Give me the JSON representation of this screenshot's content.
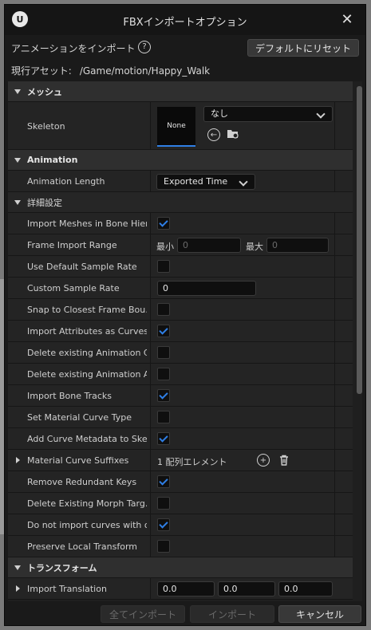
{
  "window": {
    "title": "FBXインポートオプション",
    "logo_glyph": "U",
    "close_glyph": "✕"
  },
  "topbar": {
    "animation_import_label": "アニメーションをインポート",
    "help_glyph": "?",
    "default_reset_button": "デフォルトにリセット"
  },
  "current_asset": {
    "label": "現行アセット:",
    "path": "/Game/motion/Happy_Walk"
  },
  "mesh_section": {
    "title": "メッシュ",
    "skeleton": {
      "label": "Skeleton",
      "thumbnail_text": "None",
      "dropdown_value": "なし",
      "icons": [
        "use-selected-asset-icon",
        "browse-asset-icon"
      ]
    }
  },
  "animation_section": {
    "title": "Animation",
    "animation_length": {
      "label": "Animation Length",
      "value": "Exported Time"
    }
  },
  "advanced_section": {
    "title": "詳細設定",
    "rows": {
      "import_meshes_in_bone_hierarchy": {
        "label": "Import Meshes in Bone Hier…",
        "checked": true
      },
      "frame_import_range": {
        "label": "Frame Import Range",
        "min_label": "最小",
        "min_value": "0",
        "max_label": "最大",
        "max_value": "0"
      },
      "use_default_sample_rate": {
        "label": "Use Default Sample Rate",
        "checked": false
      },
      "custom_sample_rate": {
        "label": "Custom Sample Rate",
        "value": "0"
      },
      "snap_to_closest_frame": {
        "label": "Snap to Closest Frame Bou…",
        "checked": false
      },
      "import_attributes_as_curves": {
        "label": "Import Attributes as Curves…",
        "checked": true
      },
      "delete_existing_animation_curves": {
        "label": "Delete existing Animation C…",
        "checked": false
      },
      "delete_existing_animation_attributes": {
        "label": "Delete existing Animation A…",
        "checked": false
      },
      "import_bone_tracks": {
        "label": "Import Bone Tracks",
        "checked": true
      },
      "set_material_curve_type": {
        "label": "Set Material Curve Type",
        "checked": false
      },
      "add_curve_metadata": {
        "label": "Add Curve Metadata to Skel…",
        "checked": true
      },
      "material_curve_suffixes": {
        "label": "Material Curve Suffixes",
        "value": "1 配列エレメント",
        "add_glyph": "+",
        "delete_glyph": "🗑"
      },
      "remove_redundant_keys": {
        "label": "Remove Redundant Keys",
        "checked": true
      },
      "delete_existing_morph_targets": {
        "label": "Delete Existing Morph Targ…",
        "checked": false
      },
      "do_not_import_curves": {
        "label": "Do not import curves with o…",
        "checked": true
      },
      "preserve_local_transform": {
        "label": "Preserve Local Transform",
        "checked": false
      }
    }
  },
  "transform_section": {
    "title": "トランスフォーム",
    "import_translation": {
      "label": "Import Translation",
      "x": "0.0",
      "y": "0.0",
      "z": "0.0"
    }
  },
  "footer": {
    "import_all_button": "全てインポート",
    "import_button": "インポート",
    "cancel_button": "キャンセル"
  },
  "colors": {
    "accent": "#2f7fe6",
    "window_bg": "#1a1a1a",
    "row_bg": "#242424",
    "section_bg": "#2f2f2f"
  }
}
